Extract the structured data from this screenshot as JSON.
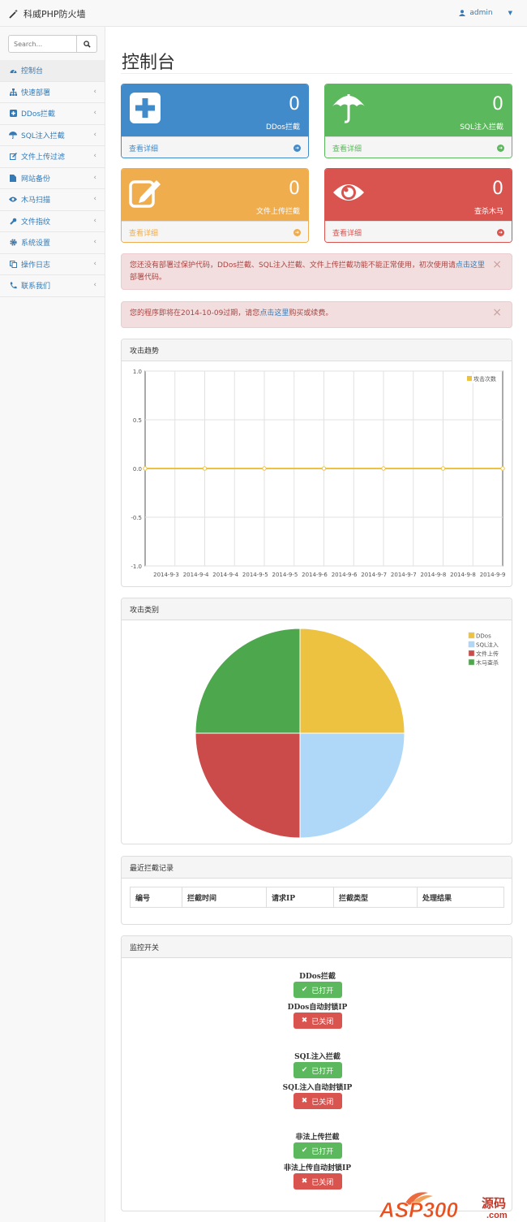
{
  "app": {
    "title": "科威PHP防火墙",
    "user": "admin"
  },
  "sidebar": {
    "search_placeholder": "Search...",
    "items": [
      {
        "label": "控制台",
        "icon": "dashboard-icon",
        "active": true
      },
      {
        "label": "快速部署",
        "icon": "sitemap-icon"
      },
      {
        "label": "DDos拦截",
        "icon": "plus-square-icon"
      },
      {
        "label": "SQL注入拦截",
        "icon": "umbrella-icon"
      },
      {
        "label": "文件上传过滤",
        "icon": "edit-icon"
      },
      {
        "label": "网站备份",
        "icon": "file-icon"
      },
      {
        "label": "木马扫描",
        "icon": "eye-icon"
      },
      {
        "label": "文件指纹",
        "icon": "wrench-icon"
      },
      {
        "label": "系统设置",
        "icon": "gear-icon"
      },
      {
        "label": "操作日志",
        "icon": "copy-icon"
      },
      {
        "label": "联系我们",
        "icon": "phone-icon"
      }
    ]
  },
  "page_title": "控制台",
  "stats": [
    {
      "count": "0",
      "label": "DDos拦截",
      "link": "查看详细",
      "icon": "plus-icon",
      "color": "#428bca"
    },
    {
      "count": "0",
      "label": "SQL注入拦截",
      "link": "查看详细",
      "icon": "umbrella-icon",
      "color": "#5cb85c"
    },
    {
      "count": "0",
      "label": "文件上传拦截",
      "link": "查看详细",
      "icon": "edit-icon",
      "color": "#f0ad4e"
    },
    {
      "count": "0",
      "label": "查杀木马",
      "link": "查看详细",
      "icon": "eye-icon",
      "color": "#d9534f"
    }
  ],
  "alerts": {
    "deploy": {
      "text": "您还没有部署过保护代码，DDos拦截、SQL注入拦截、文件上传拦截功能不能正常使用，初次使用请",
      "link": "点击这里",
      "tail": "部署代码。"
    },
    "expire": {
      "text": "您的程序即将在2014-10-09过期，请您",
      "link": "点击这里",
      "tail": "购买或续费。"
    }
  },
  "trend_panel": {
    "title": "攻击趋势"
  },
  "category_panel": {
    "title": "攻击类别"
  },
  "chart_data": [
    {
      "type": "line",
      "title": "攻击趋势",
      "x": [
        "2014-9-3",
        "2014-9-4",
        "2014-9-4",
        "2014-9-5",
        "2014-9-5",
        "2014-9-6",
        "2014-9-6",
        "2014-9-7",
        "2014-9-7",
        "2014-9-8",
        "2014-9-8",
        "2014-9-9"
      ],
      "series": [
        {
          "name": "攻击次数",
          "values": [
            0,
            0,
            0,
            0,
            0,
            0,
            0,
            0,
            0,
            0,
            0,
            0,
            0
          ],
          "color": "#edc240"
        }
      ],
      "y_ticks": [
        "1.0",
        "0.5",
        "0.0",
        "-0.5",
        "-1.0"
      ],
      "ylim": [
        -1,
        1
      ],
      "grid": true,
      "legend": "top-right"
    },
    {
      "type": "pie",
      "title": "攻击类别",
      "slices": [
        {
          "name": "DDos",
          "value": 25,
          "color": "#edc240"
        },
        {
          "name": "SQL注入",
          "value": 25,
          "color": "#afd8f8"
        },
        {
          "name": "文件上传",
          "value": 25,
          "color": "#cb4b4b"
        },
        {
          "name": "木马查杀",
          "value": 25,
          "color": "#4da74d"
        }
      ],
      "legend": "top-right"
    }
  ],
  "records": {
    "title": "最近拦截记录",
    "columns": [
      "编号",
      "拦截时间",
      "请求IP",
      "拦截类型",
      "处理结果"
    ]
  },
  "monitor": {
    "title": "监控开关",
    "groups": [
      {
        "title": "DDos拦截",
        "state": "已打开",
        "auto_title": "DDos自动封锁IP",
        "auto_state": "已关闭"
      },
      {
        "title": "SQL注入拦截",
        "state": "已打开",
        "auto_title": "SQL注入自动封锁IP",
        "auto_state": "已关闭"
      },
      {
        "title": "非法上传拦截",
        "state": "已打开",
        "auto_title": "非法上传自动封锁IP",
        "auto_state": "已关闭"
      }
    ]
  },
  "watermark": {
    "brand": "ASP300",
    "suffix": "源码",
    "domain": ".com"
  }
}
